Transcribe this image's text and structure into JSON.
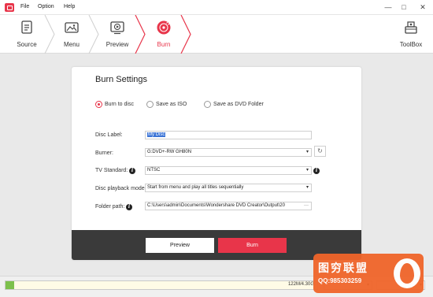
{
  "menubar": {
    "items": [
      "File",
      "Option",
      "Help"
    ],
    "minimize": "—",
    "restore": "□",
    "close": "✕"
  },
  "steps": [
    {
      "label": "Source",
      "icon": "source-document-icon",
      "active": false
    },
    {
      "label": "Menu",
      "icon": "menu-image-icon",
      "active": false
    },
    {
      "label": "Preview",
      "icon": "preview-play-icon",
      "active": false
    },
    {
      "label": "Burn",
      "icon": "burn-disc-icon",
      "active": true
    }
  ],
  "toolbox": {
    "label": "ToolBox",
    "icon": "toolbox-icon"
  },
  "burn_settings": {
    "title": "Burn Settings",
    "options": [
      {
        "label": "Burn to disc",
        "selected": true
      },
      {
        "label": "Save as ISO",
        "selected": false
      },
      {
        "label": "Save as DVD Folder",
        "selected": false
      }
    ],
    "disc_label": {
      "label": "Disc Label:",
      "value": "My Disc"
    },
    "burner": {
      "label": "Burner:",
      "value": "G:DVD+-RW GH80N"
    },
    "tv_standard": {
      "label": "TV Standard:",
      "value": "NTSC"
    },
    "disc_playback_mode": {
      "label": "Disc playback mode:",
      "value": "Start from menu and play all titles sequentially"
    },
    "folder_path": {
      "label": "Folder path:",
      "value": "C:\\Users\\admin\\Documents\\Wondershare DVD Creator\\Output\\20"
    },
    "folder_browse": "···",
    "preview_button": "Preview",
    "burn_button": "Burn"
  },
  "status": {
    "capacity_text": "122M/4.30G",
    "capacity_fraction": 0.028,
    "accent_color": "#e8354a",
    "fill_color": "#7cc04b"
  },
  "watermark": {
    "line1": "图穷联盟",
    "line2": "QQ:985303259"
  }
}
